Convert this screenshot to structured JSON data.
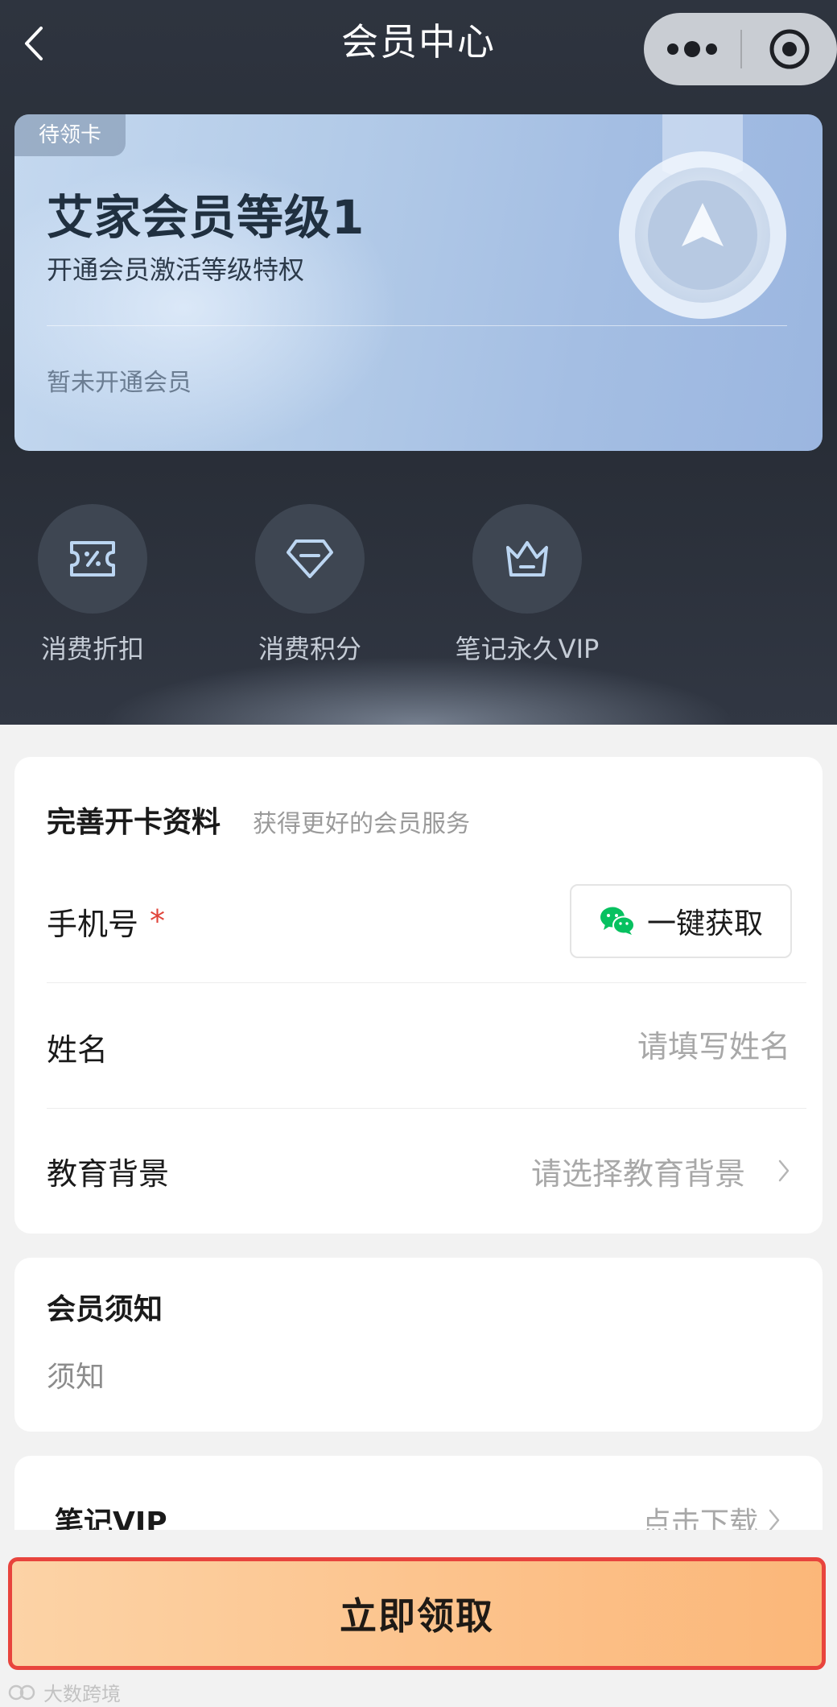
{
  "nav": {
    "title": "会员中心"
  },
  "card": {
    "tag": "待领卡",
    "title": "艾家会员等级1",
    "subtitle": "开通会员激活等级特权",
    "status": "暂未开通会员"
  },
  "benefits": [
    {
      "label": "消费折扣",
      "icon": "discount-ticket-icon"
    },
    {
      "label": "消费积分",
      "icon": "diamond-icon"
    },
    {
      "label": "笔记永久VIP",
      "icon": "crown-icon"
    }
  ],
  "form": {
    "title": "完善开卡资料",
    "hint": "获得更好的会员服务",
    "phone_label": "手机号",
    "required_mark": "*",
    "wechat_button": "一键获取",
    "name_label": "姓名",
    "name_placeholder": "请填写姓名",
    "education_label": "教育背景",
    "education_placeholder": "请选择教育背景"
  },
  "notice": {
    "title": "会员须知",
    "body": "须知"
  },
  "vip": {
    "label": "笔记VIP",
    "action": "点击下载"
  },
  "claim_button": "立即领取",
  "watermark": "大数跨境",
  "colors": {
    "header_bg": "#2b313b",
    "card_blue": "#a9c3e6",
    "claim_orange": "#fcc48e",
    "claim_border": "#e8443d",
    "required_red": "#e0443a",
    "wechat_green": "#07c160"
  }
}
